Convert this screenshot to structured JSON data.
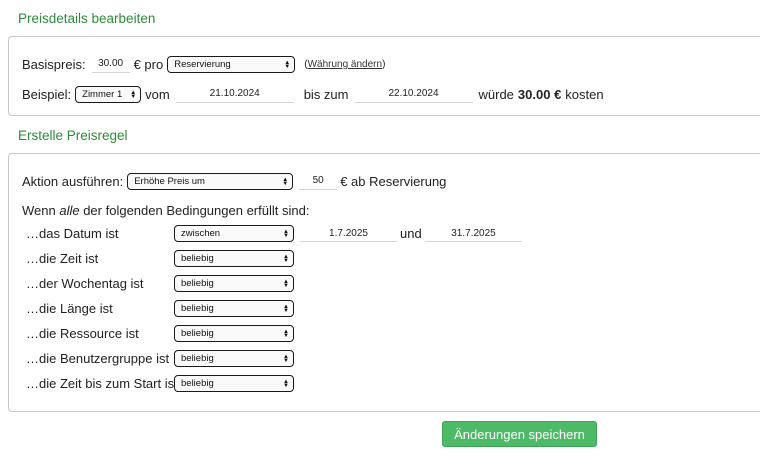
{
  "price_details": {
    "title": "Preisdetails bearbeiten",
    "base_price_label": "Basispreis:",
    "base_price_value": "30.00",
    "currency_per": "€ pro",
    "unit_select": "Reservierung",
    "change_currency_link": "Währung ändern",
    "example_label": "Beispiel:",
    "example_room_select": "Zimmer 1",
    "from_label": "vom",
    "from_date": "21.10.2024",
    "to_label": "bis zum",
    "to_date": "22.10.2024",
    "would_cost_prefix": "würde",
    "would_cost_amount": "30.00 €",
    "would_cost_suffix": "kosten"
  },
  "price_rule": {
    "title": "Erstelle Preisregel",
    "action_label": "Aktion ausführen:",
    "action_select": "Erhöhe Preis um",
    "action_value": "50",
    "action_suffix": "€ ab Reservierung",
    "conditions_intro_before": "Wenn ",
    "conditions_intro_em": "alle",
    "conditions_intro_after": " der folgenden Bedingungen erfüllt sind:",
    "date_between_and": "und",
    "conditions": [
      {
        "label": "…das Datum ist",
        "select": "zwischen",
        "from": "1.7.2025",
        "to": "31.7.2025"
      },
      {
        "label": "…die Zeit ist",
        "select": "beliebig"
      },
      {
        "label": "…der Wochentag ist",
        "select": "beliebig"
      },
      {
        "label": "…die Länge ist",
        "select": "beliebig"
      },
      {
        "label": "…die Ressource ist",
        "select": "beliebig"
      },
      {
        "label": "…die Benutzergruppe ist",
        "select": "beliebig"
      },
      {
        "label": "…die Zeit bis zum Start ist",
        "select": "beliebig"
      }
    ]
  },
  "save_button": "Änderungen speichern",
  "colors": {
    "accent_green": "#2e8b3a",
    "button_green": "#4cba67"
  }
}
